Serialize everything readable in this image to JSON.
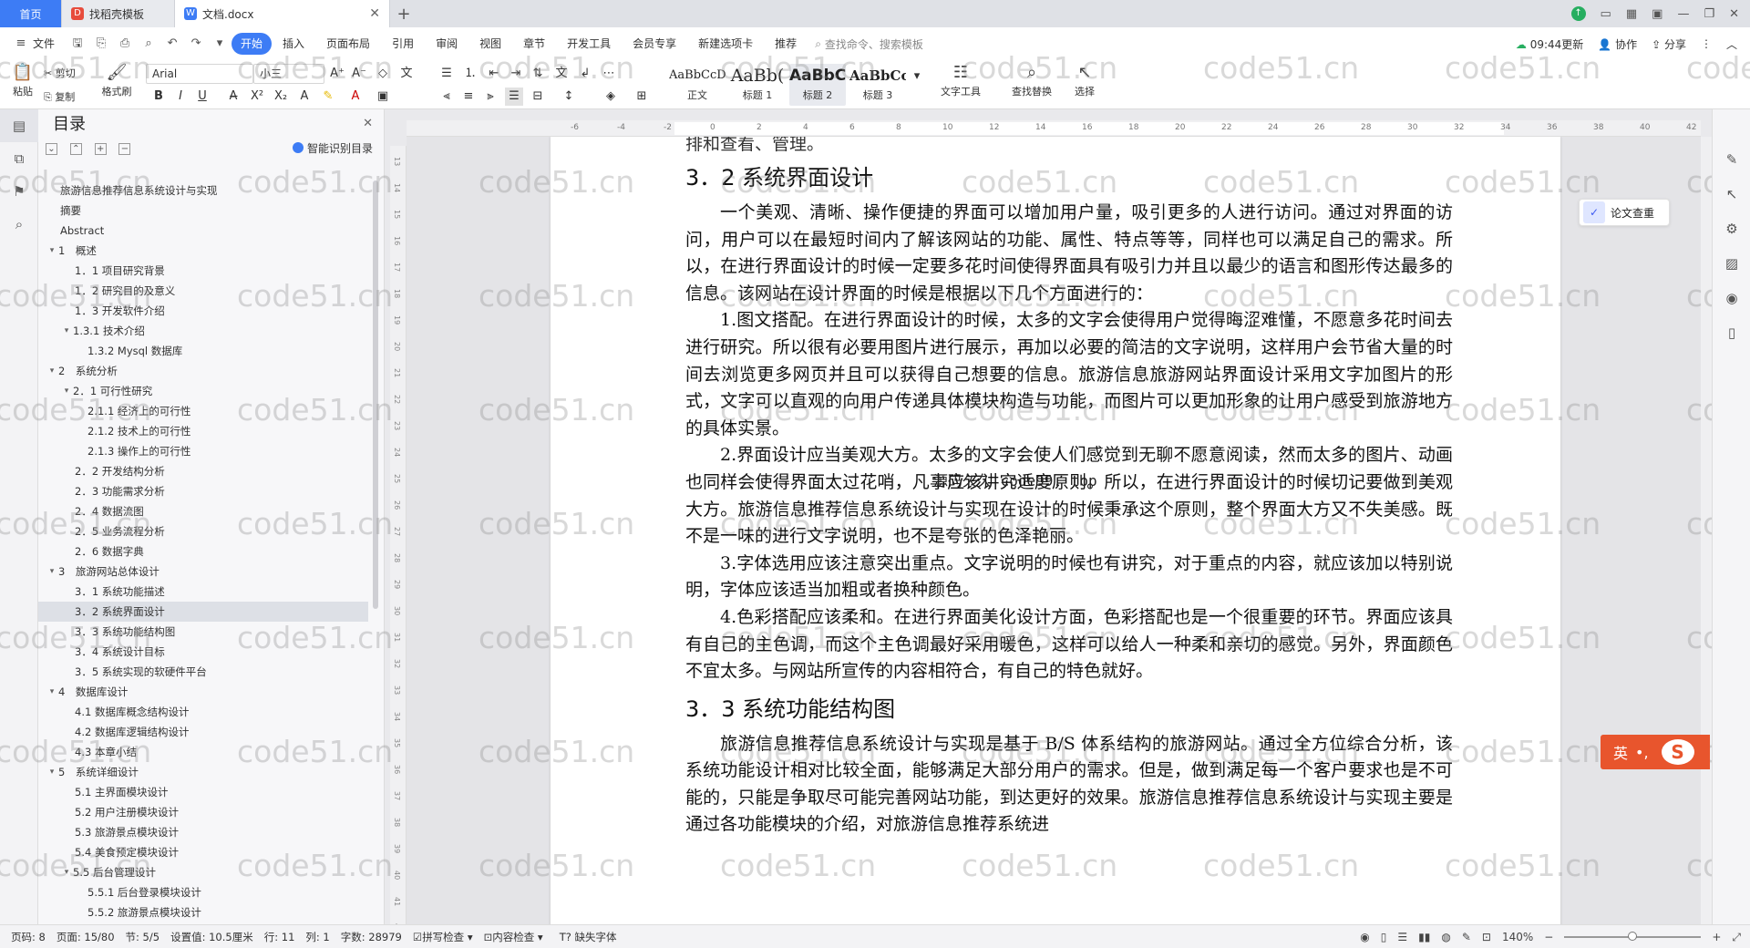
{
  "tabs": {
    "home": "首页",
    "t1": "找稻壳模板",
    "t2": "文档.docx"
  },
  "menu": {
    "file": "文件",
    "items": [
      "开始",
      "插入",
      "页面布局",
      "引用",
      "审阅",
      "视图",
      "章节",
      "开发工具",
      "会员专享",
      "新建选项卡",
      "推荐"
    ],
    "search": "查找命令、搜索模板",
    "update": "09:44更新",
    "collab": "协作",
    "share": "分享"
  },
  "ribbon": {
    "cut": "剪切",
    "copy": "复制",
    "paste": "粘贴",
    "brush": "格式刷",
    "font": "Arial",
    "size": "小三",
    "styles": [
      {
        "preview": "AaBbCcDd",
        "name": "正文"
      },
      {
        "preview": "AaBb(",
        "name": "标题 1"
      },
      {
        "preview": "AaBbC",
        "name": "标题 2"
      },
      {
        "preview": "AaBbCcI",
        "name": "标题 3"
      }
    ],
    "text_tool": "文字工具",
    "find_replace": "查找替换",
    "select": "选择"
  },
  "toc": {
    "title": "目录",
    "smart": "智能识别目录",
    "items": [
      {
        "t": "旅游信息推荐信息系统设计与实现",
        "l": 0,
        "a": ""
      },
      {
        "t": "摘要",
        "l": 0,
        "a": ""
      },
      {
        "t": "Abstract",
        "l": 0,
        "a": ""
      },
      {
        "t": "1　概述",
        "l": 0,
        "a": "v"
      },
      {
        "t": "1．1 项目研究背景",
        "l": 1,
        "a": ""
      },
      {
        "t": "1．2 研究目的及意义",
        "l": 1,
        "a": ""
      },
      {
        "t": "1．3 开发软件介绍",
        "l": 1,
        "a": ""
      },
      {
        "t": "1.3.1 技术介绍",
        "l": 1,
        "a": "v"
      },
      {
        "t": "1.3.2 Mysql 数据库",
        "l": 2,
        "a": ""
      },
      {
        "t": "2　系统分析",
        "l": 0,
        "a": "v"
      },
      {
        "t": "2．1 可行性研究",
        "l": 1,
        "a": "v"
      },
      {
        "t": "2.1.1 经济上的可行性",
        "l": 2,
        "a": ""
      },
      {
        "t": "2.1.2 技术上的可行性",
        "l": 2,
        "a": ""
      },
      {
        "t": "2.1.3 操作上的可行性",
        "l": 2,
        "a": ""
      },
      {
        "t": "2．2 开发结构分析",
        "l": 1,
        "a": ""
      },
      {
        "t": "2．3 功能需求分析",
        "l": 1,
        "a": ""
      },
      {
        "t": "2．4 数据流图",
        "l": 1,
        "a": ""
      },
      {
        "t": "2．5 业务流程分析",
        "l": 1,
        "a": ""
      },
      {
        "t": "2．6 数据字典",
        "l": 1,
        "a": ""
      },
      {
        "t": "3　旅游网站总体设计",
        "l": 0,
        "a": "v"
      },
      {
        "t": "3．1 系统功能描述",
        "l": 1,
        "a": ""
      },
      {
        "t": "3．2 系统界面设计",
        "l": 1,
        "a": "",
        "sel": true
      },
      {
        "t": "3．3 系统功能结构图",
        "l": 1,
        "a": ""
      },
      {
        "t": "3．4 系统设计目标",
        "l": 1,
        "a": ""
      },
      {
        "t": "3．5 系统实现的软硬件平台",
        "l": 1,
        "a": ""
      },
      {
        "t": "4　数据库设计",
        "l": 0,
        "a": "v"
      },
      {
        "t": "4.1 数据库概念结构设计",
        "l": 1,
        "a": ""
      },
      {
        "t": "4.2 数据库逻辑结构设计",
        "l": 1,
        "a": ""
      },
      {
        "t": "4.3 本章小结",
        "l": 1,
        "a": ""
      },
      {
        "t": "5　系统详细设计",
        "l": 0,
        "a": "v"
      },
      {
        "t": "5.1 主界面模块设计",
        "l": 1,
        "a": ""
      },
      {
        "t": "5.2 用户注册模块设计",
        "l": 1,
        "a": ""
      },
      {
        "t": "5.3 旅游景点模块设计",
        "l": 1,
        "a": ""
      },
      {
        "t": "5.4 美食预定模块设计",
        "l": 1,
        "a": ""
      },
      {
        "t": "5.5 后台管理设计",
        "l": 1,
        "a": "v"
      },
      {
        "t": "5.5.1 后台登录模块设计",
        "l": 2,
        "a": ""
      },
      {
        "t": "5.5.2 旅游景点模块设计",
        "l": 2,
        "a": ""
      }
    ]
  },
  "doc": {
    "frag": "排和查看、管理。",
    "h32": "3．2 系统界面设计",
    "p1": "一个美观、清晰、操作便捷的界面可以增加用户量，吸引更多的人进行访问。通过对界面的访问，用户可以在最短时间内了解该网站的功能、属性、特点等等，同样也可以满足自己的需求。所以，在进行界面设计的时候一定要多花时间使得界面具有吸引力并且以最少的语言和图形传达最多的信息。该网站在设计界面的时候是根据以下几个方面进行的：",
    "p2": "1.图文搭配。在进行界面设计的时候，太多的文字会使得用户觉得晦涩难懂，不愿意多花时间去进行研究。所以很有必要用图片进行展示，再加以必要的简洁的文字说明，这样用户会节省大量的时间去浏览更多网页并且可以获得自己想要的信息。旅游信息旅游网站界面设计采用文字加图片的形式，文字可以直观的向用户传递具体模块构造与功能，而图片可以更加形象的让用户感受到旅游地方的具体实景。",
    "p3": "2.界面设计应当美观大方。太多的文字会使人们感觉到无聊不愿意阅读，然而太多的图片、动画也同样会使得界面太过花哨，凡事应该讲究适度原则。所以，在进行界面设计的时候切记要做到美观大方。旅游信息推荐信息系统设计与实现在设计的时候秉承这个原则，整个界面大方又不失美感。既不是一味的进行文字说明，也不是夸张的色泽艳丽。",
    "p4": "3.字体选用应该注意突出重点。文字说明的时候也有讲究，对于重点的内容，就应该加以特别说明，字体应该适当加粗或者换种颜色。",
    "p5": "4.色彩搭配应该柔和。在进行界面美化设计方面，色彩搭配也是一个很重要的环节。界面应该具有自己的主色调，而这个主色调最好采用暖色，这样可以给人一种柔和亲切的感觉。另外，界面颜色不宜太多。与网站所宣传的内容相符合，有自己的特色就好。",
    "h33": "3．3 系统功能结构图",
    "p6": "旅游信息推荐信息系统设计与实现是基于 B/S 体系结构的旅游网站。通过全方位综合分析，该系统功能设计相对比较全面，能够满足大部分用户的需求。但是，做到满足每一个客户要求也是不可能的，只能是争取尽可能完善网站功能，到达更好的效果。旅游信息推荐信息系统设计与实现主要是通过各功能模块的介绍，对旅游信息推荐系统进",
    "overlay": "源码久久 code99. top"
  },
  "watermark": "code51.cn",
  "essay_check": "论文查重",
  "ime": "英",
  "status": {
    "pages_label": "页码: 8",
    "page": "页面: 15/80",
    "section": "节: 5/5",
    "setting": "设置值: 10.5厘米",
    "row": "行: 11",
    "col": "列: 1",
    "words": "字数: 28979",
    "spell": "拼写检查",
    "content": "内容检查",
    "missing_font": "缺失字体",
    "zoom": "140%"
  },
  "colors": {
    "accent": "#3d7cf5",
    "ime": "#e8552d"
  }
}
